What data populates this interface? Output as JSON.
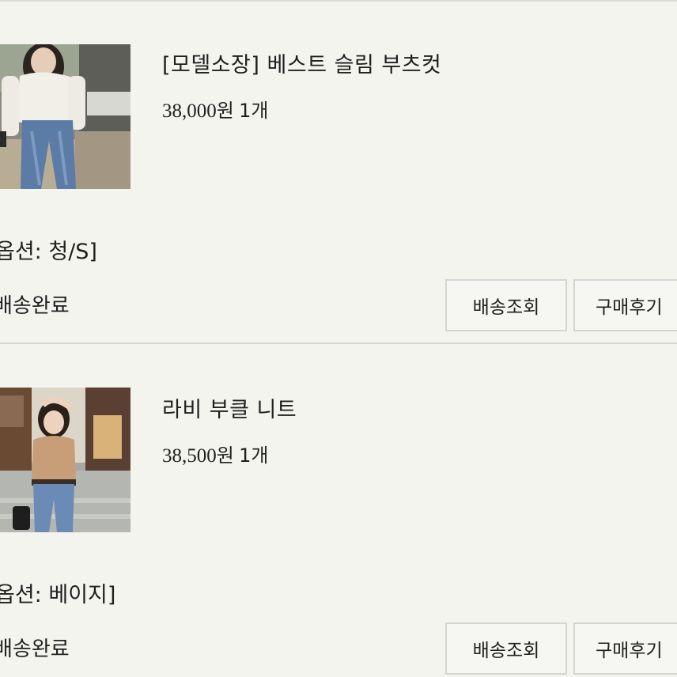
{
  "orders": [
    {
      "product_name": "[모델소장] 베스트 슬림 부츠컷",
      "price": "38,000",
      "price_unit": "원",
      "quantity": "1개",
      "option": "옵션: 청/S]",
      "status": "배송완료",
      "track_label": "배송조회",
      "review_label": "구매후기"
    },
    {
      "product_name": "라비 부클 니트",
      "price": "38,500",
      "price_unit": "원",
      "quantity": "1개",
      "option": "옵션: 베이지]",
      "status": "배송완료",
      "track_label": "배송조회",
      "review_label": "구매후기"
    }
  ],
  "colors": {
    "background": "#f4f4ef",
    "divider": "#d8d8d2",
    "button_border": "#d6d6d0",
    "text": "#1f1f1f"
  }
}
